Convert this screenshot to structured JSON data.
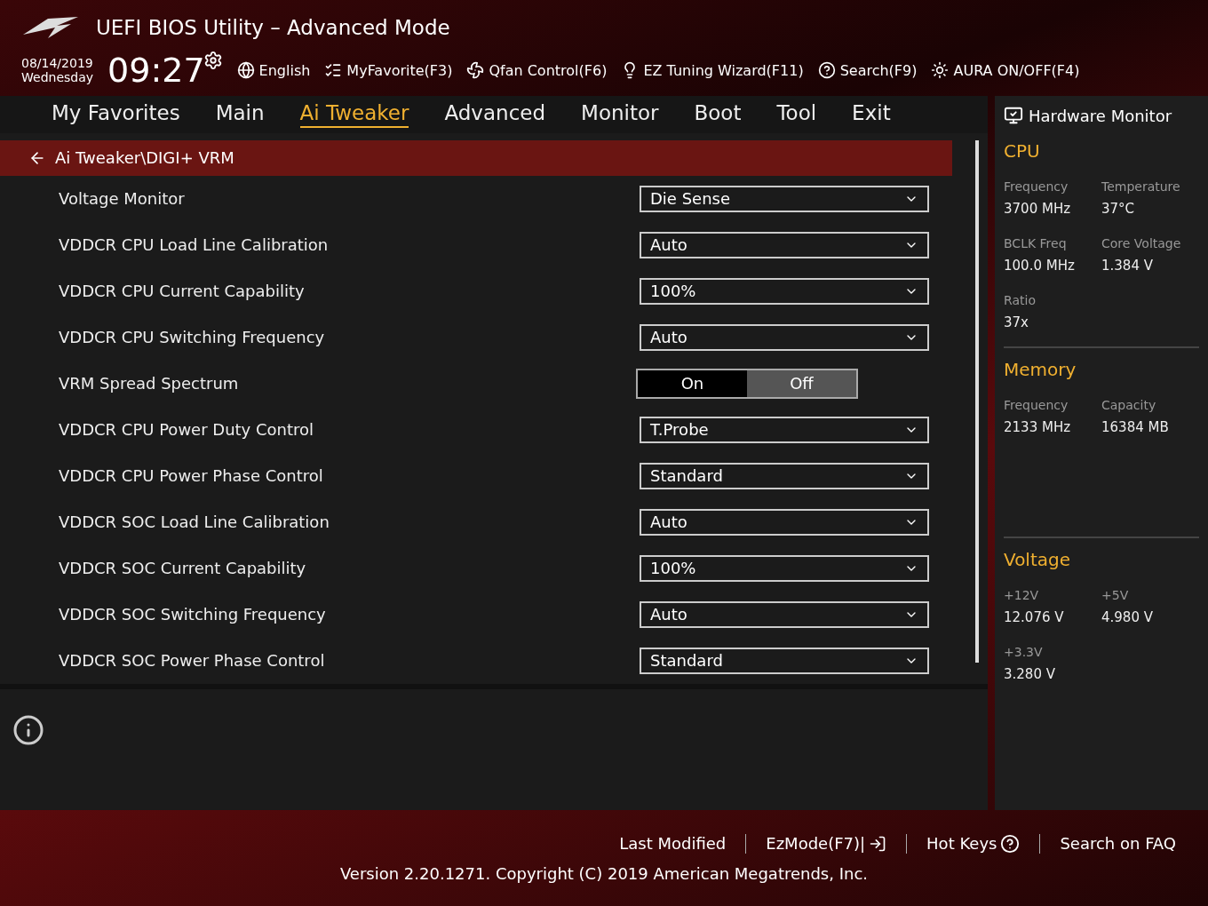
{
  "header": {
    "title": "UEFI BIOS Utility – Advanced Mode",
    "date": "08/14/2019",
    "weekday": "Wednesday",
    "time": "09:27",
    "tools": [
      {
        "kind": "globe",
        "label": "English"
      },
      {
        "kind": "favorite",
        "label": "MyFavorite(F3)"
      },
      {
        "kind": "fan",
        "label": "Qfan Control(F6)"
      },
      {
        "kind": "bulb",
        "label": "EZ Tuning Wizard(F11)"
      },
      {
        "kind": "search",
        "label": "Search(F9)"
      },
      {
        "kind": "aura",
        "label": "AURA ON/OFF(F4)"
      }
    ]
  },
  "tabs": [
    {
      "label": "My Favorites",
      "selected": false
    },
    {
      "label": "Main",
      "selected": false
    },
    {
      "label": "Ai Tweaker",
      "selected": true
    },
    {
      "label": "Advanced",
      "selected": false
    },
    {
      "label": "Monitor",
      "selected": false
    },
    {
      "label": "Boot",
      "selected": false
    },
    {
      "label": "Tool",
      "selected": false
    },
    {
      "label": "Exit",
      "selected": false
    }
  ],
  "breadcrumb": "Ai Tweaker\\DIGI+ VRM",
  "settings": [
    {
      "kind": "dropdown",
      "label": "Voltage Monitor",
      "value": "Die Sense"
    },
    {
      "kind": "dropdown",
      "label": "VDDCR CPU Load Line Calibration",
      "value": "Auto"
    },
    {
      "kind": "dropdown",
      "label": "VDDCR CPU Current Capability",
      "value": "100%"
    },
    {
      "kind": "dropdown",
      "label": "VDDCR CPU Switching Frequency",
      "value": "Auto"
    },
    {
      "kind": "toggle",
      "label": "VRM Spread Spectrum",
      "options": [
        {
          "label": "On",
          "selected": false
        },
        {
          "label": "Off",
          "selected": true
        }
      ]
    },
    {
      "kind": "dropdown",
      "label": "VDDCR CPU Power Duty Control",
      "value": "T.Probe"
    },
    {
      "kind": "dropdown",
      "label": "VDDCR CPU Power Phase Control",
      "value": "Standard"
    },
    {
      "kind": "dropdown",
      "label": "VDDCR SOC Load Line Calibration",
      "value": "Auto"
    },
    {
      "kind": "dropdown",
      "label": "VDDCR SOC Current Capability",
      "value": "100%"
    },
    {
      "kind": "dropdown",
      "label": "VDDCR SOC Switching Frequency",
      "value": "Auto"
    },
    {
      "kind": "dropdown",
      "label": "VDDCR SOC Power Phase Control",
      "value": "Standard"
    }
  ],
  "hardware_monitor": {
    "title": "Hardware Monitor",
    "sections": [
      {
        "title": "CPU",
        "items": [
          {
            "label": "Frequency",
            "value": "3700 MHz"
          },
          {
            "label": "Temperature",
            "value": "37°C"
          },
          {
            "label": "BCLK Freq",
            "value": "100.0 MHz"
          },
          {
            "label": "Core Voltage",
            "value": "1.384 V"
          },
          {
            "label": "Ratio",
            "value": "37x"
          }
        ]
      },
      {
        "title": "Memory",
        "items": [
          {
            "label": "Frequency",
            "value": "2133 MHz"
          },
          {
            "label": "Capacity",
            "value": "16384 MB"
          }
        ]
      },
      {
        "title": "Voltage",
        "items": [
          {
            "label": "+12V",
            "value": "12.076 V"
          },
          {
            "label": "+5V",
            "value": "4.980 V"
          },
          {
            "label": "+3.3V",
            "value": "3.280 V"
          }
        ]
      }
    ]
  },
  "footer": {
    "links": [
      {
        "kind": "plain",
        "label": "Last Modified"
      },
      {
        "kind": "exit",
        "label": "EzMode(F7)|"
      },
      {
        "kind": "help",
        "label": "Hot Keys"
      },
      {
        "kind": "plain",
        "label": "Search on FAQ"
      }
    ],
    "version": "Version 2.20.1271. Copyright (C) 2019 American Megatrends, Inc."
  }
}
